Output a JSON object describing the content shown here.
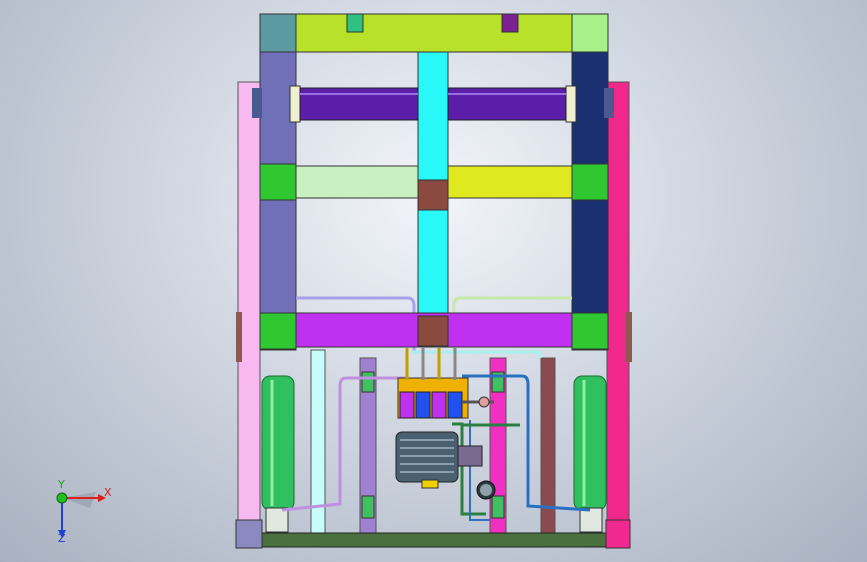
{
  "view": {
    "triad": {
      "x_label": "X",
      "y_label": "Y",
      "z_label": "Z"
    }
  },
  "colors": {
    "background_center": "#f2f5fa",
    "background_edge": "#a9b1c0",
    "top_beam": "#b8e22a",
    "teal_block": "#5a9aa0",
    "light_green_block": "#a8f08a",
    "purple_roller": "#5a1ea8",
    "violet_column": "#7070b8",
    "navy_column": "#1a3070",
    "pink_post": "#f8b8f0",
    "magenta_post": "#f0288c",
    "cyan_column": "#28f8f8",
    "pale_green_rail": "#c8f0c0",
    "yellow_rail": "#e0e820",
    "magenta_beam": "#c030f0",
    "green_plate": "#30c830",
    "brown_plate": "#8a4a40",
    "green_cylinder": "#30c060",
    "motor_body": "#4a6070",
    "base_bar": "#4a7040"
  }
}
